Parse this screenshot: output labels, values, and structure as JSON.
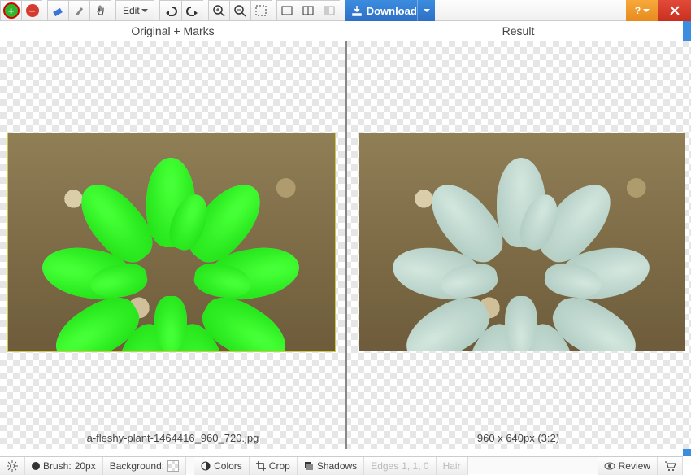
{
  "toolbar": {
    "edit_label": "Edit",
    "download_label": "Download",
    "help_label": "?"
  },
  "headers": {
    "left": "Original + Marks",
    "right": "Result"
  },
  "info": {
    "filename": "a-fleshy-plant-1464416_960_720.jpg",
    "dimensions": "960 x 640px (3:2)"
  },
  "bottom": {
    "brush_label": "Brush:",
    "brush_size": "20px",
    "background_label": "Background:",
    "colors_label": "Colors",
    "crop_label": "Crop",
    "shadows_label": "Shadows",
    "edges_label": "Edges",
    "edges_values": "1, 1, 0",
    "hair_label": "Hair",
    "review_label": "Review"
  },
  "colors": {
    "accent_blue": "#3b8de0",
    "mark_green": "#1fd615",
    "danger_red": "#d43a2e"
  }
}
